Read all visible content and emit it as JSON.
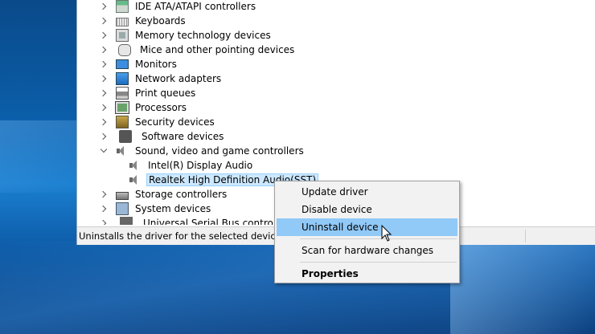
{
  "tree": {
    "items": [
      {
        "label": "IDE ATA/ATAPI controllers",
        "icon": "ide-controller-icon",
        "expanded": false
      },
      {
        "label": "Keyboards",
        "icon": "keyboard-icon",
        "expanded": false
      },
      {
        "label": "Memory technology devices",
        "icon": "memory-device-icon",
        "expanded": false
      },
      {
        "label": "Mice and other pointing devices",
        "icon": "mouse-icon",
        "expanded": false
      },
      {
        "label": "Monitors",
        "icon": "monitor-icon",
        "expanded": false
      },
      {
        "label": "Network adapters",
        "icon": "network-adapter-icon",
        "expanded": false
      },
      {
        "label": "Print queues",
        "icon": "printer-icon",
        "expanded": false
      },
      {
        "label": "Processors",
        "icon": "processor-icon",
        "expanded": false
      },
      {
        "label": "Security devices",
        "icon": "security-device-icon",
        "expanded": false
      },
      {
        "label": "Software devices",
        "icon": "software-device-icon",
        "expanded": false
      },
      {
        "label": "Sound, video and game controllers",
        "icon": "speaker-icon",
        "expanded": true
      },
      {
        "label": "Intel(R) Display Audio",
        "icon": "speaker-icon",
        "child": true
      },
      {
        "label": "Realtek High Definition Audio(SST)",
        "icon": "speaker-icon",
        "child": true,
        "selected": true
      },
      {
        "label": "Storage controllers",
        "icon": "storage-controller-icon",
        "expanded": false
      },
      {
        "label": "System devices",
        "icon": "system-device-icon",
        "expanded": false
      },
      {
        "label": "Universal Serial Bus controllers",
        "icon": "usb-icon",
        "expanded": false
      }
    ]
  },
  "statusbar": {
    "text": "Uninstalls the driver for the selected device."
  },
  "context_menu": {
    "items": [
      {
        "label": "Update driver"
      },
      {
        "label": "Disable device"
      },
      {
        "label": "Uninstall device",
        "highlighted": true
      },
      {
        "label": "Scan for hardware changes"
      },
      {
        "label": "Properties",
        "bold": true
      }
    ]
  },
  "colors": {
    "selection": "#cce8ff",
    "menu_highlight": "#91c9f7",
    "desktop": "#0b5ea9"
  }
}
